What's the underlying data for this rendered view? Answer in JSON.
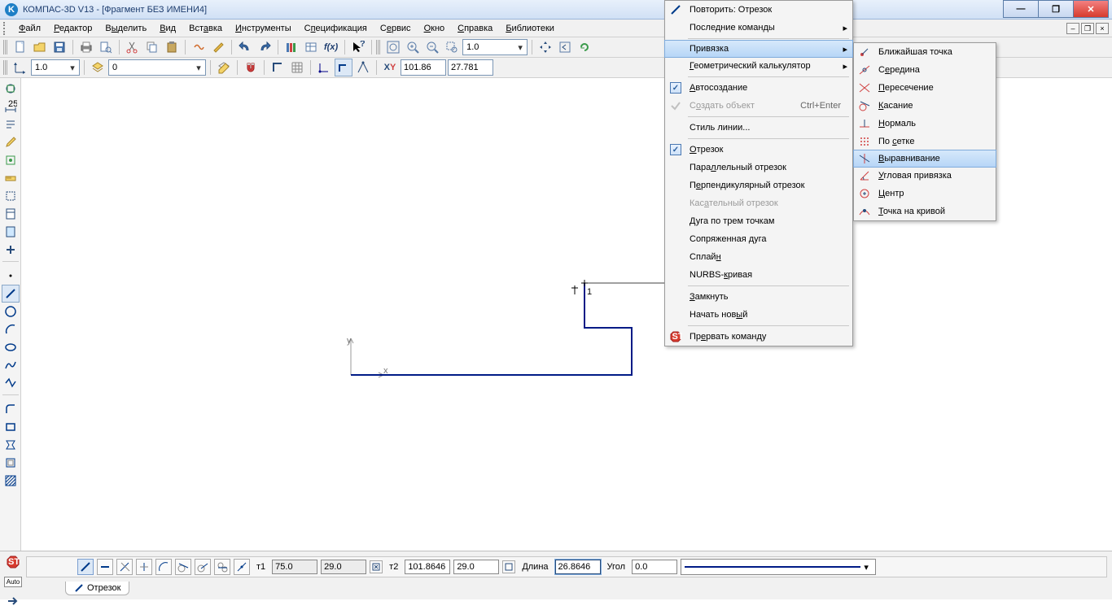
{
  "title": "КОМПАС-3D V13 - [Фрагмент БЕЗ ИМЕНИ4]",
  "menu": {
    "file": "Файл",
    "edit": "Редактор",
    "select": "Выделить",
    "view": "Вид",
    "insert": "Вставка",
    "tools": "Инструменты",
    "spec": "Спецификация",
    "service": "Сервис",
    "window": "Окно",
    "help": "Справка",
    "libs": "Библиотеки"
  },
  "toolbar2": {
    "scale": "1.0",
    "coordX": "101.86",
    "coordY": "27.781",
    "layer": "0",
    "zoom": "1.0"
  },
  "context_menu1": {
    "repeat": "Повторить: Отрезок",
    "recent": "Последние команды",
    "snap": "Привязка",
    "geocalc": "Геометрический калькулятор",
    "autocreate": "Автосоздание",
    "create": "Создать объект",
    "create_key": "Ctrl+Enter",
    "linestyle": "Стиль линии...",
    "segment": "Отрезок",
    "parallel": "Параллельный отрезок",
    "perpend": "Перпендикулярный отрезок",
    "tangent": "Касательный отрезок",
    "arc3": "Дуга по трем точкам",
    "conjarc": "Сопряженная дуга",
    "spline": "Сплайн",
    "nurbs": "NURBS-кривая",
    "close": "Замкнуть",
    "startnew": "Начать новый",
    "abort": "Прервать команду"
  },
  "snap_menu": {
    "nearest": "Ближайшая точка",
    "midpoint": "Середина",
    "intersect": "Пересечение",
    "tangent": "Касание",
    "normal": "Нормаль",
    "grid": "По сетке",
    "align": "Выравнивание",
    "angular": "Угловая привязка",
    "center": "Центр",
    "pointcurve": "Точка на кривой"
  },
  "bottom": {
    "t1": "т1",
    "t1_x": "75.0",
    "t1_y": "29.0",
    "t2": "т2",
    "t2_x": "101.8646",
    "t2_y": "29.0",
    "lenlab": "Длина",
    "len": "26.8646",
    "anglab": "Угол",
    "ang": "0.0",
    "tab": "Отрезок"
  },
  "canvas": {
    "anchor_label": "1",
    "x_label": "x",
    "y_label": "y"
  }
}
